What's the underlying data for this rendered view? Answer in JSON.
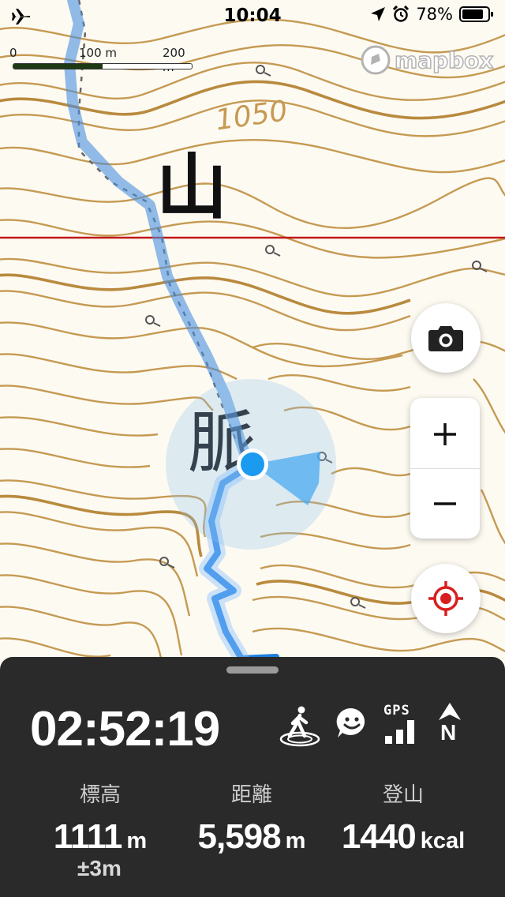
{
  "status_bar": {
    "time": "10:04",
    "battery": "78%"
  },
  "map": {
    "scale": {
      "label_0": "0",
      "label_100": "100 m",
      "label_200": "200 m"
    },
    "attribution": "mapbox",
    "contour_label": "1050",
    "place_name_chars": [
      "山",
      "脈"
    ]
  },
  "panel": {
    "elapsed_time": "02:52:19",
    "stats": {
      "elevation": {
        "label": "標高",
        "value": "1111",
        "unit": "m",
        "accuracy": "±3m"
      },
      "distance": {
        "label": "距離",
        "value": "5,598",
        "unit": "m"
      },
      "calories": {
        "label": "登山",
        "value": "1440",
        "unit": "kcal"
      }
    },
    "icons": {
      "activity": "walking-person-icon",
      "message": "smiley-bubble-icon",
      "gps_label": "GPS",
      "compass_label": "N"
    }
  },
  "colors": {
    "contour": "#c59a52",
    "track": "#4a90e0",
    "location": "#1a9bf0",
    "boundary": "#c01818",
    "panel_bg": "#2a2a2a",
    "locate_red": "#d81e1e"
  }
}
